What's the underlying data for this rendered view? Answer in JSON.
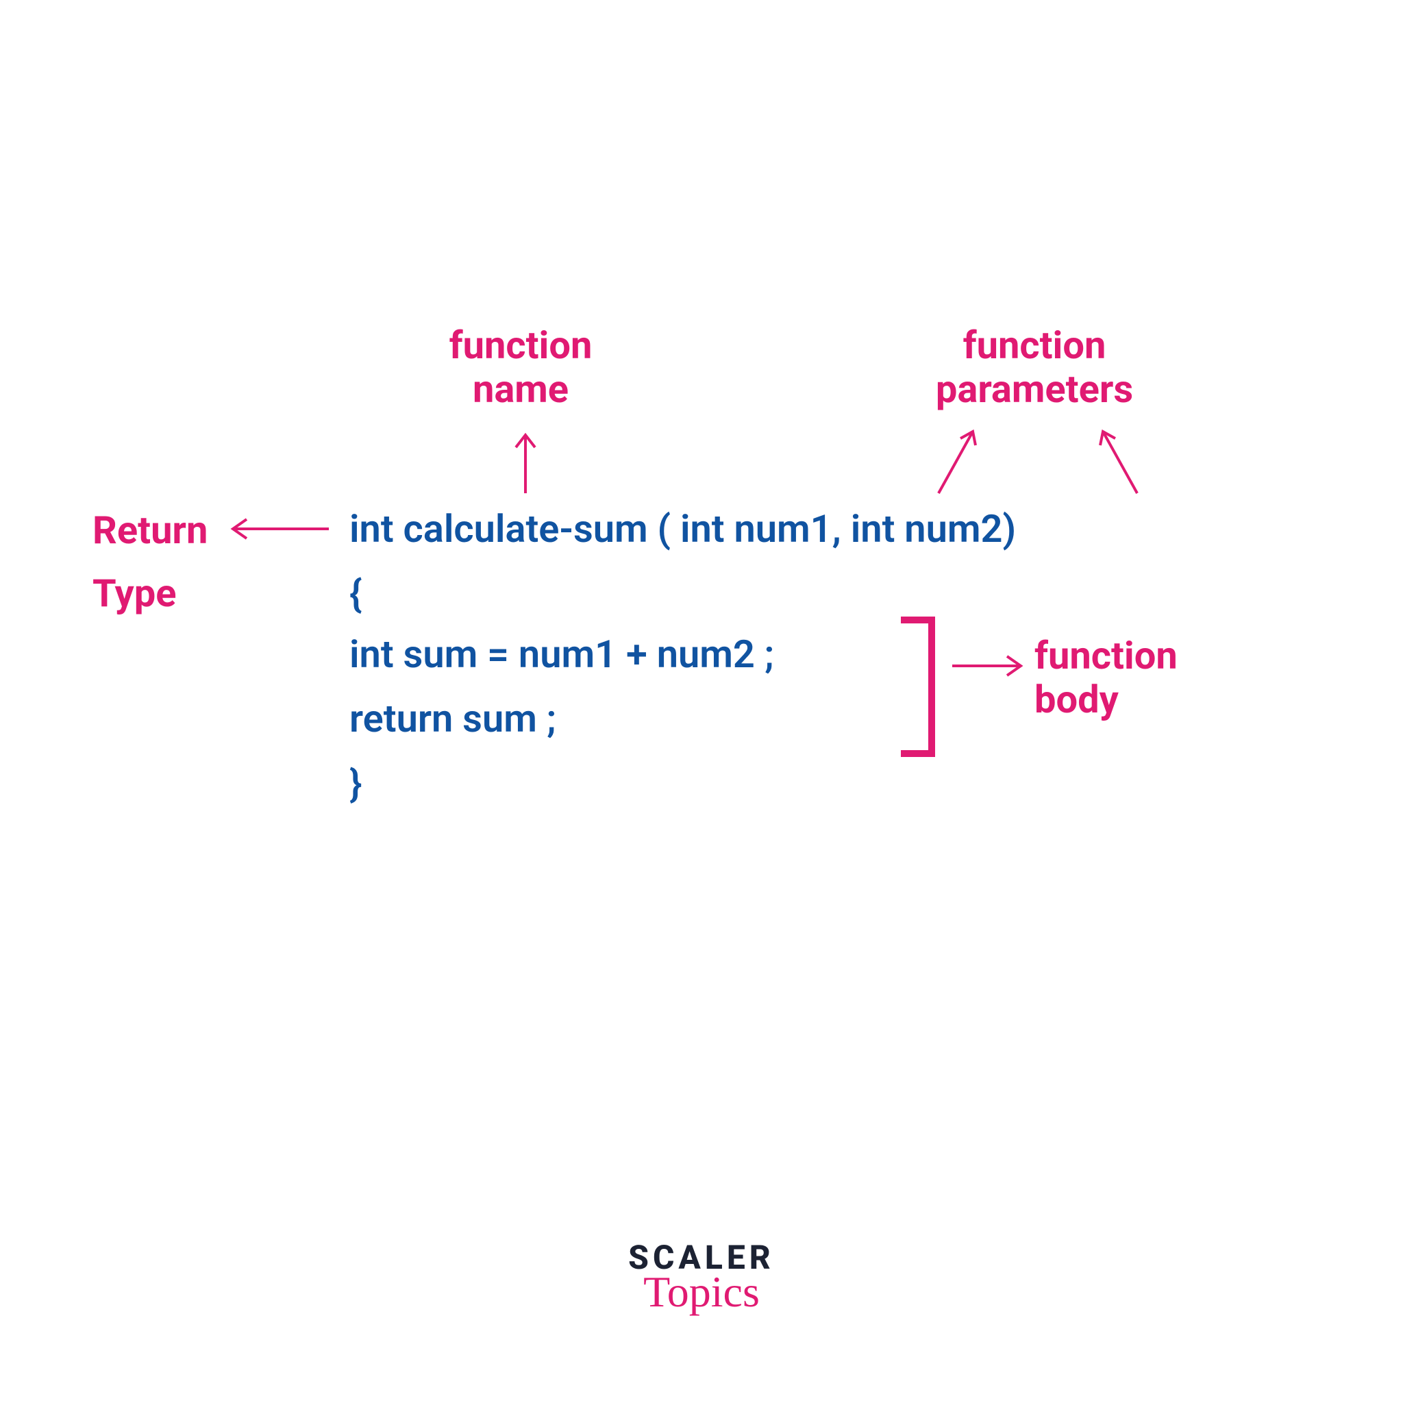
{
  "labels": {
    "function_name_line1": "function",
    "function_name_line2": "name",
    "function_params_line1": "function",
    "function_params_line2": "parameters",
    "return_type_line1": "Return",
    "return_type_line2": "Type",
    "function_body_line1": "function",
    "function_body_line2": "body"
  },
  "code": {
    "signature": "int  calculate-sum ( int num1, int num2)",
    "open_brace": "{",
    "body_line1": "int sum = num1 + num2 ;",
    "body_line2": "return sum ;",
    "close_brace": "}"
  },
  "logo": {
    "top": "SCALER",
    "bottom": "Topics"
  },
  "colors": {
    "pink": "#e01a72",
    "blue": "#1053a1",
    "dark": "#1c2233"
  }
}
